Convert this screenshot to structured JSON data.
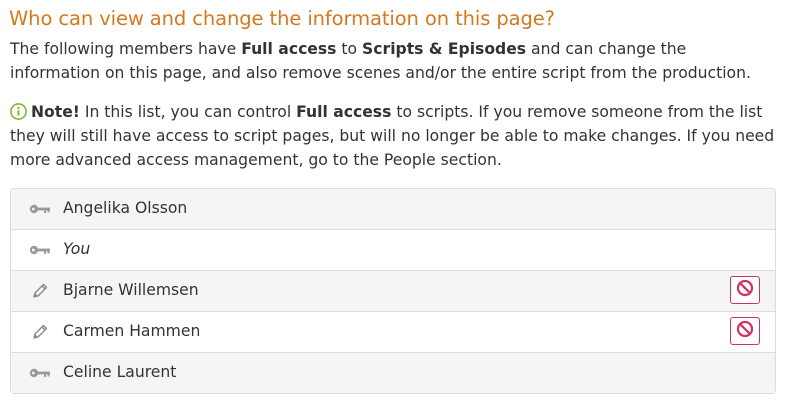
{
  "heading": "Who can view and change the information on this page?",
  "intro": {
    "t1": "The following members have ",
    "b1": "Full access",
    "t2": " to ",
    "b2": "Scripts & Episodes",
    "t3": " and can change the information on this page, and also remove scenes and/or the entire script from the production."
  },
  "note": {
    "icon": "info-circle-icon",
    "label": "Note!",
    "t1": " In this list, you can control ",
    "b1": "Full access",
    "t2": " to scripts. If you remove someone from the list they will still have access to script pages, but will no longer be able to make changes. If you need more advanced access management, go to the People section."
  },
  "members": [
    {
      "name": "Angelika Olsson",
      "icon": "key-icon"
    },
    {
      "name": "You",
      "icon": "key-icon"
    },
    {
      "name": "Bjarne Willemsen",
      "icon": "pencil-icon",
      "removable": true
    },
    {
      "name": "Carmen Hammen",
      "icon": "pencil-icon",
      "removable": true
    },
    {
      "name": "Celine Laurent",
      "icon": "key-icon"
    }
  ],
  "colors": {
    "heading": "#d4781e",
    "note_icon": "#7ab51d",
    "remove": "#cc3366",
    "row_shade": "#f5f5f5",
    "border": "#dcdcdc"
  }
}
